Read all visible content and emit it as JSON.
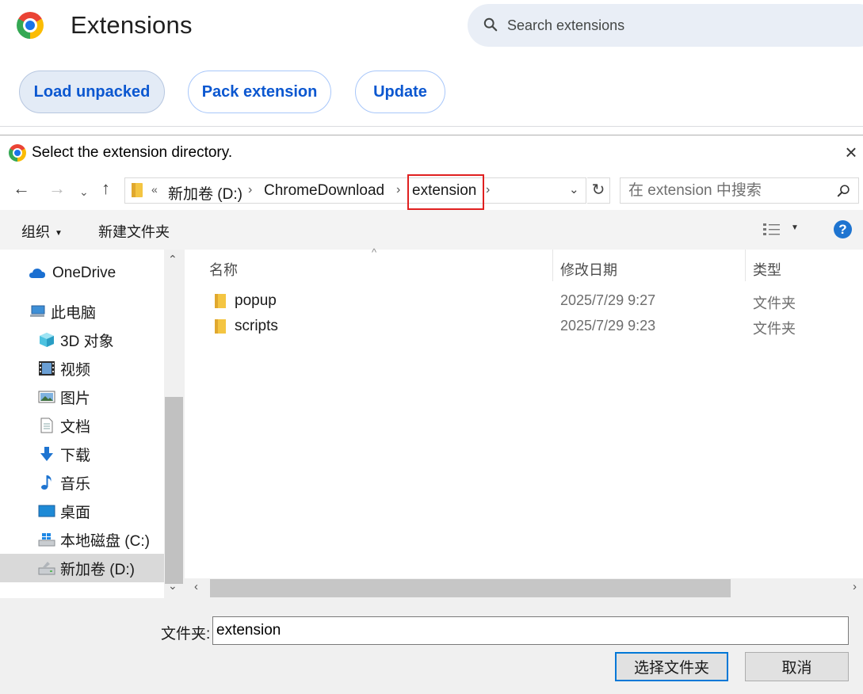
{
  "ext_page": {
    "title": "Extensions",
    "search_placeholder": "Search extensions",
    "buttons": {
      "load": "Load unpacked",
      "pack": "Pack extension",
      "update": "Update"
    }
  },
  "dialog": {
    "title": "Select the extension directory.",
    "close": "×",
    "nav": {
      "back": "←",
      "forward": "→",
      "dropdown": "⌄",
      "up": "↑"
    },
    "address": {
      "overflow": "«",
      "segments": [
        "新加卷 (D:)",
        "ChromeDownload",
        "extension"
      ],
      "separator": "›",
      "dropdown": "⌄",
      "refresh": "↻"
    },
    "search_placeholder": "在 extension 中搜索",
    "toolbar": {
      "organize": "组织",
      "organize_caret": "▼",
      "new_folder": "新建文件夹",
      "view_caret": "▼",
      "help": "?"
    },
    "nav_pane": {
      "items": [
        "OneDrive",
        "此电脑",
        "3D 对象",
        "视频",
        "图片",
        "文档",
        "下载",
        "音乐",
        "桌面",
        "本地磁盘 (C:)",
        "新加卷 (D:)"
      ],
      "scroll_up": "⌃",
      "scroll_down": "⌄"
    },
    "columns": {
      "name": "名称",
      "date": "修改日期",
      "type": "类型"
    },
    "files": [
      {
        "name": "popup",
        "date": "2025/7/29 9:27",
        "type": "文件夹"
      },
      {
        "name": "scripts",
        "date": "2025/7/29 9:23",
        "type": "文件夹"
      }
    ],
    "hscroll": {
      "left": "‹",
      "right": "›"
    },
    "folder_label": "文件夹:",
    "folder_value": "extension",
    "select_button": "选择文件夹",
    "cancel_button": "取消"
  },
  "colors": {
    "accent_blue": "#0b57d0",
    "highlight_red": "#e02020",
    "dialog_bg": "#f0f0f0"
  }
}
